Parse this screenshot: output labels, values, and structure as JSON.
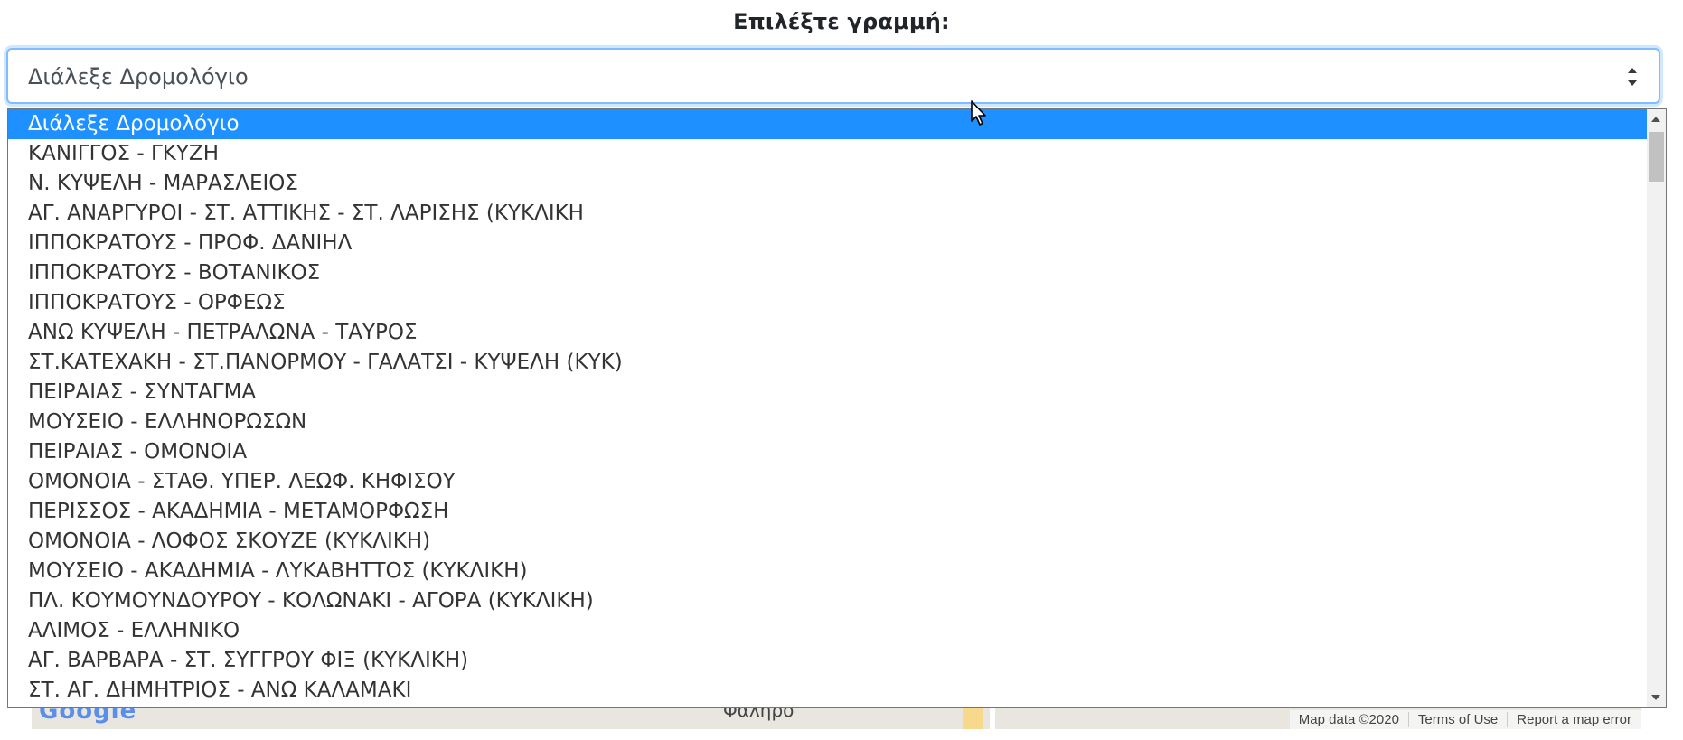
{
  "header": {
    "label": "Επιλέξτε γραμμή:"
  },
  "select": {
    "value": "Διάλεξε Δρομολόγιο"
  },
  "dropdown": {
    "options": [
      "Διάλεξε Δρομολόγιο",
      "ΚΑΝΙΓΓΟΣ - ΓΚΥΖΗ",
      "Ν. ΚΥΨΕΛΗ - ΜΑΡΑΣΛΕΙΟΣ",
      "ΑΓ. ΑΝΑΡΓΥΡΟΙ - ΣΤ. ΑΤΤΙΚΗΣ - ΣΤ. ΛΑΡΙΣΗΣ (ΚΥΚΛΙΚΗ",
      "ΙΠΠΟΚΡΑΤΟΥΣ - ΠΡΟΦ. ΔΑΝΙΗΛ",
      "ΙΠΠΟΚΡΑΤΟΥΣ - ΒΟΤΑΝΙΚΟΣ",
      "ΙΠΠΟΚΡΑΤΟΥΣ - ΟΡΦΕΩΣ",
      "ΑΝΩ ΚΥΨΕΛΗ - ΠΕΤΡΑΛΩΝΑ - ΤΑΥΡΟΣ",
      "ΣΤ.ΚΑΤΕΧΑΚΗ - ΣΤ.ΠΑΝΟΡΜΟΥ - ΓΑΛΑΤΣΙ - ΚΥΨΕΛΗ (ΚΥΚ)",
      "ΠΕΙΡΑΙΑΣ - ΣΥΝΤΑΓΜΑ",
      "ΜΟΥΣΕΙΟ - ΕΛΛΗΝΟΡΩΣΩΝ",
      "ΠΕΙΡΑΙΑΣ - ΟΜΟΝΟΙΑ",
      "ΟΜΟΝΟΙΑ - ΣΤΑΘ. ΥΠΕΡ. ΛΕΩΦ. ΚΗΦΙΣΟΥ",
      "ΠΕΡΙΣΣΟΣ - ΑΚΑΔΗΜΙΑ - ΜΕΤΑΜΟΡΦΩΣΗ",
      "ΟΜΟΝΟΙΑ - ΛΟΦΟΣ ΣΚΟΥΖΕ (ΚΥΚΛΙΚΗ)",
      "ΜΟΥΣΕΙΟ - ΑΚΑΔΗΜΙΑ - ΛΥΚΑΒΗΤΤΟΣ (ΚΥΚΛΙΚΗ)",
      "ΠΛ. ΚΟΥΜΟΥΝΔΟΥΡΟΥ - ΚΟΛΩΝΑΚΙ - ΑΓΟΡΑ (ΚΥΚΛΙΚΗ)",
      "ΑΛΙΜΟΣ - ΕΛΛΗΝΙΚΟ",
      "ΑΓ. ΒΑΡΒΑΡΑ - ΣΤ. ΣΥΓΓΡΟΥ ΦΙΞ (ΚΥΚΛΙΚΗ)",
      "ΣΤ. ΑΓ. ΔΗΜΗΤΡΙΟΣ - ΑΝΩ ΚΑΛΑΜΑΚΙ"
    ],
    "selected_index": 0
  },
  "map": {
    "place_label": "Φαληρο",
    "logo": "Google",
    "attribution": [
      "Map data ©2020",
      "Terms of Use",
      "Report a map error"
    ]
  },
  "colors": {
    "highlight": "#1e90ff",
    "focus_border": "#80bdff",
    "option_text": "#333333"
  },
  "icons": {
    "select_arrows": "up-down-chevron-icon",
    "cursor": "mouse-pointer-icon"
  }
}
